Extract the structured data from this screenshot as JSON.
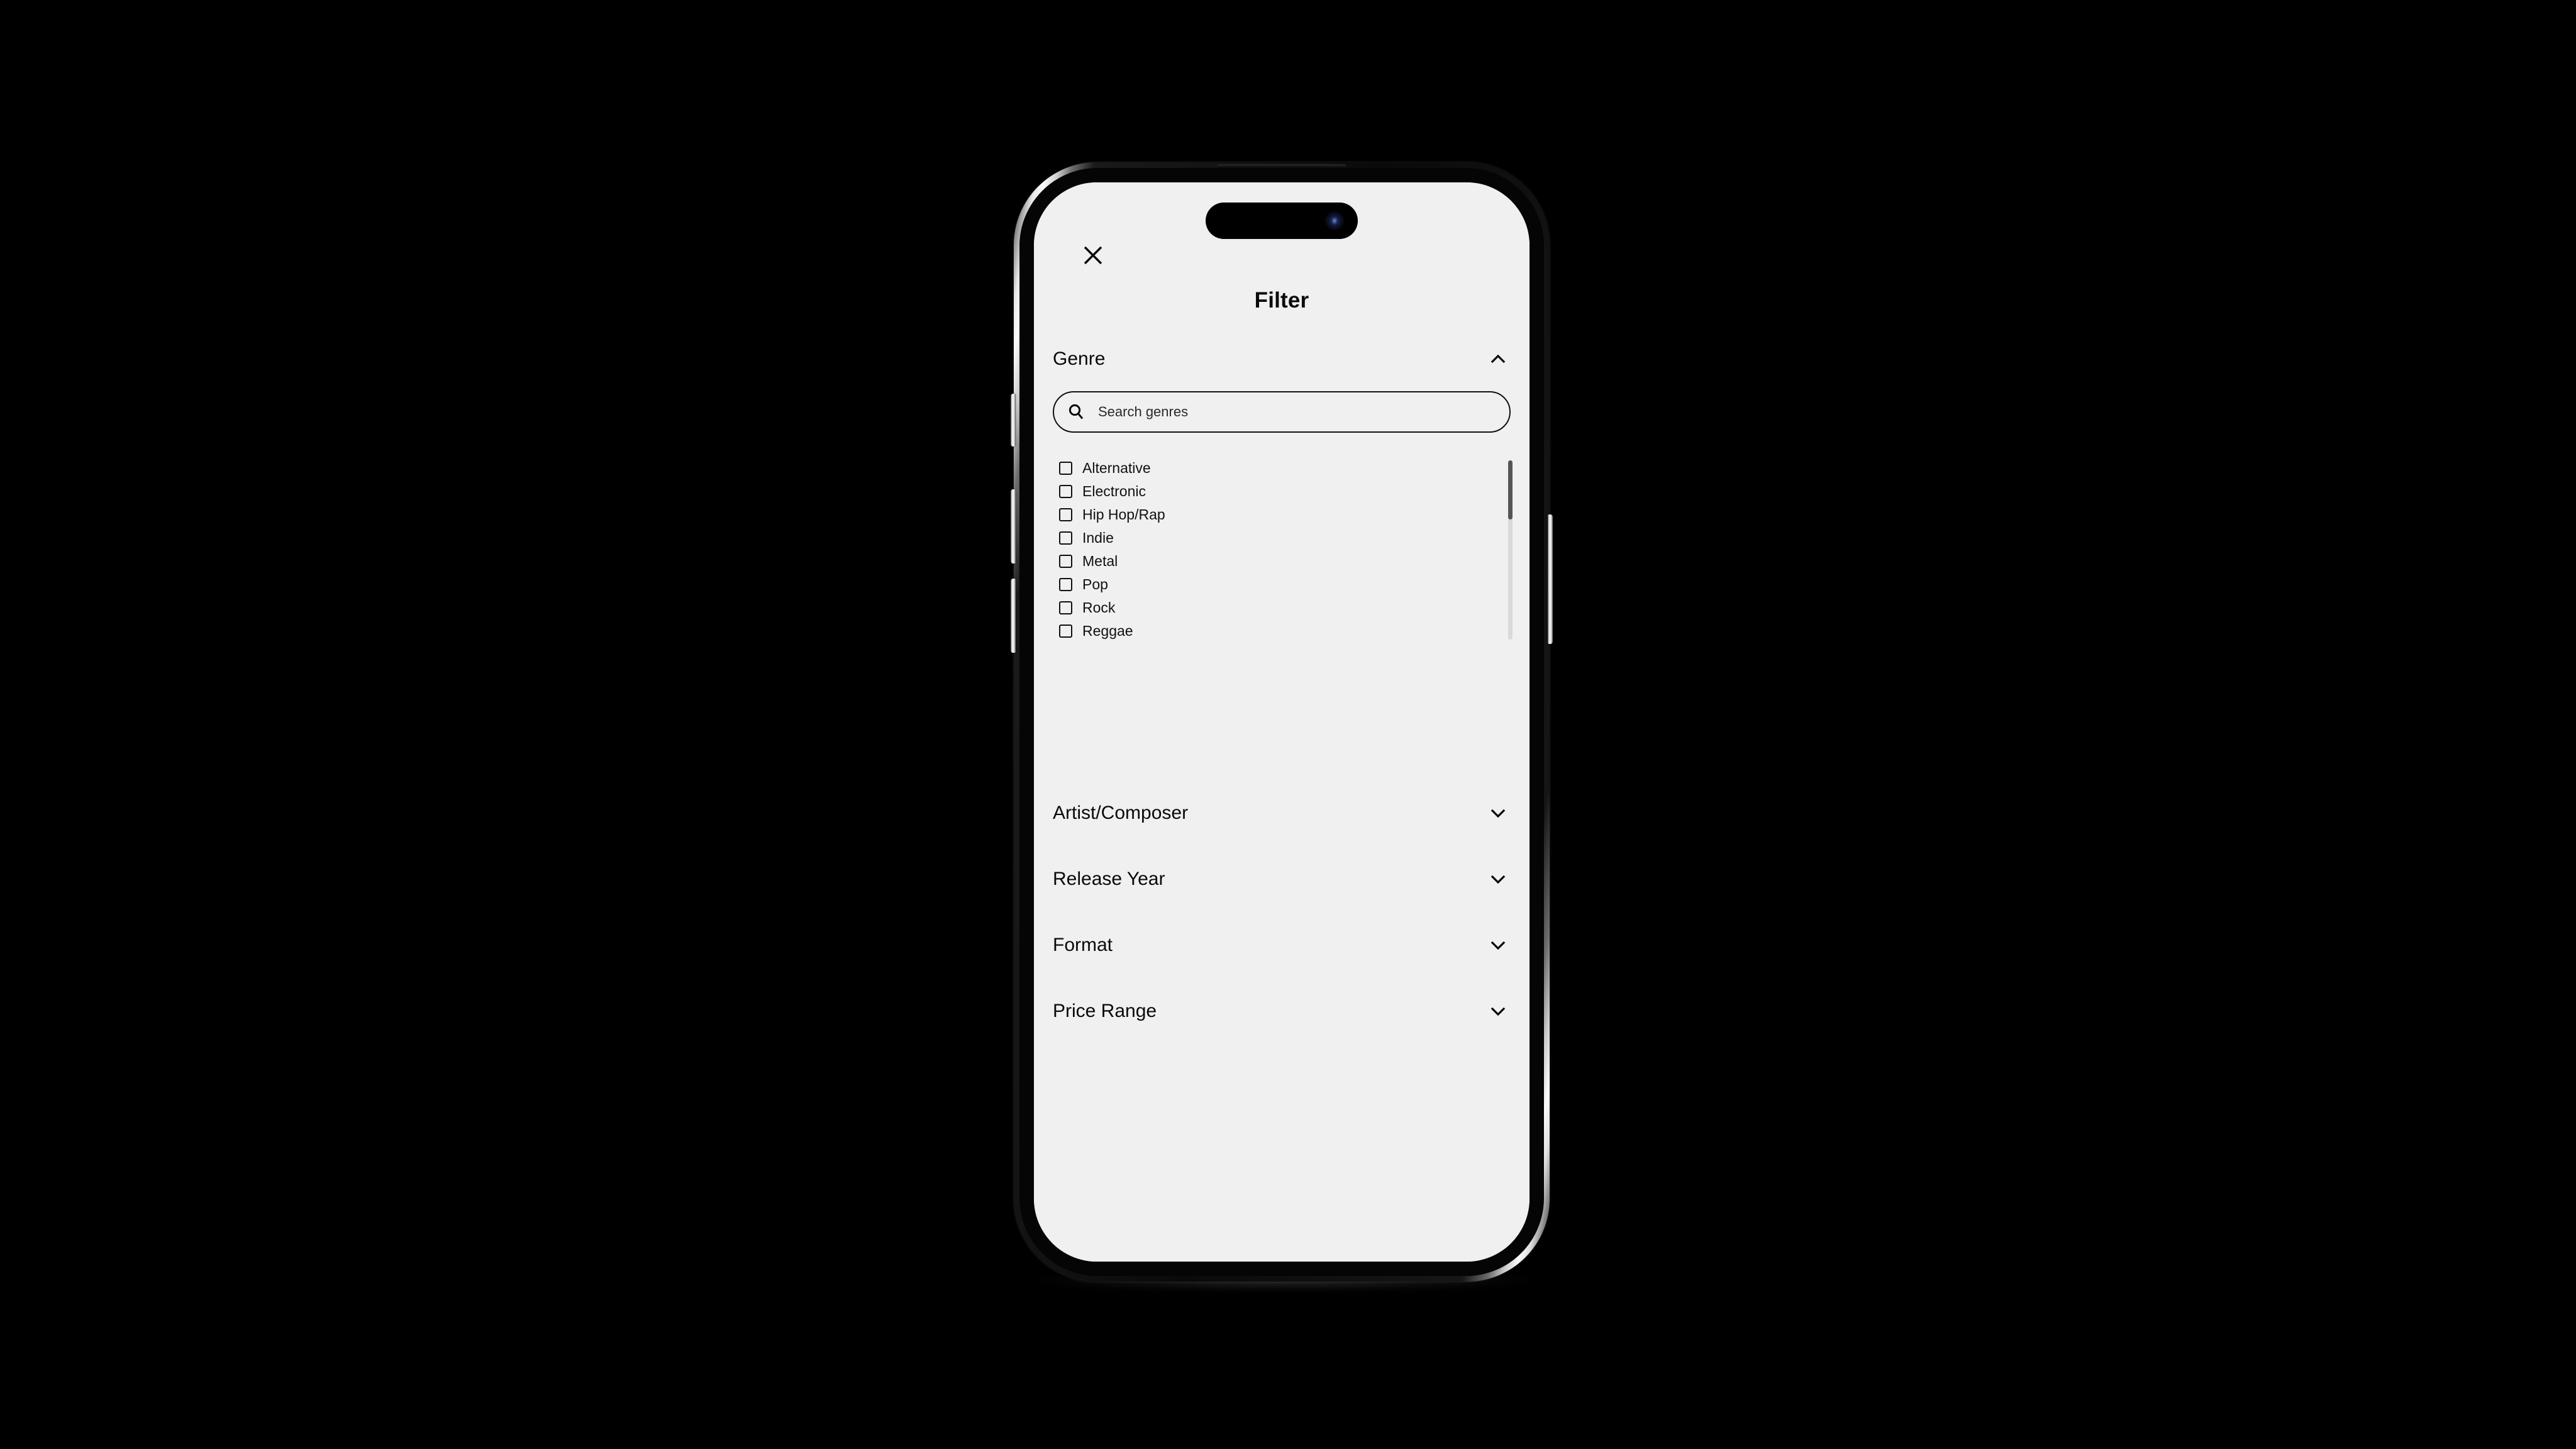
{
  "app": {
    "screen_title": "Filter",
    "background_color": "#f0f0f0",
    "text_color": "#111111"
  },
  "header": {
    "close_label": "close-icon",
    "title": "Filter"
  },
  "search": {
    "placeholder": "Search genres",
    "value": "",
    "icon": "search-icon"
  },
  "sections": [
    {
      "label": "Genre",
      "expanded": true,
      "chevron": "chevron-up-icon"
    },
    {
      "label": "Artist/Composer",
      "expanded": false,
      "chevron": "chevron-down-icon"
    },
    {
      "label": "Release Year",
      "expanded": false,
      "chevron": "chevron-down-icon"
    },
    {
      "label": "Format",
      "expanded": false,
      "chevron": "chevron-down-icon"
    },
    {
      "label": "Price Range",
      "expanded": false,
      "chevron": "chevron-down-icon"
    }
  ],
  "genres": [
    {
      "label": "Alternative",
      "checked": false
    },
    {
      "label": "Electronic",
      "checked": false
    },
    {
      "label": "Hip Hop/Rap",
      "checked": false
    },
    {
      "label": "Indie",
      "checked": false
    },
    {
      "label": "Metal",
      "checked": false
    },
    {
      "label": "Pop",
      "checked": false
    },
    {
      "label": "Rock",
      "checked": false
    },
    {
      "label": "Reggae",
      "checked": false
    }
  ],
  "scrollbar": {
    "thumb_color": "#555555",
    "track_color": "#d9d9d9"
  },
  "device": {
    "frame_color": "#0a0a0a",
    "rim_color": "#e8e8e8",
    "buttons": [
      "action-button",
      "volume-up-button",
      "volume-down-button",
      "power-button"
    ]
  }
}
